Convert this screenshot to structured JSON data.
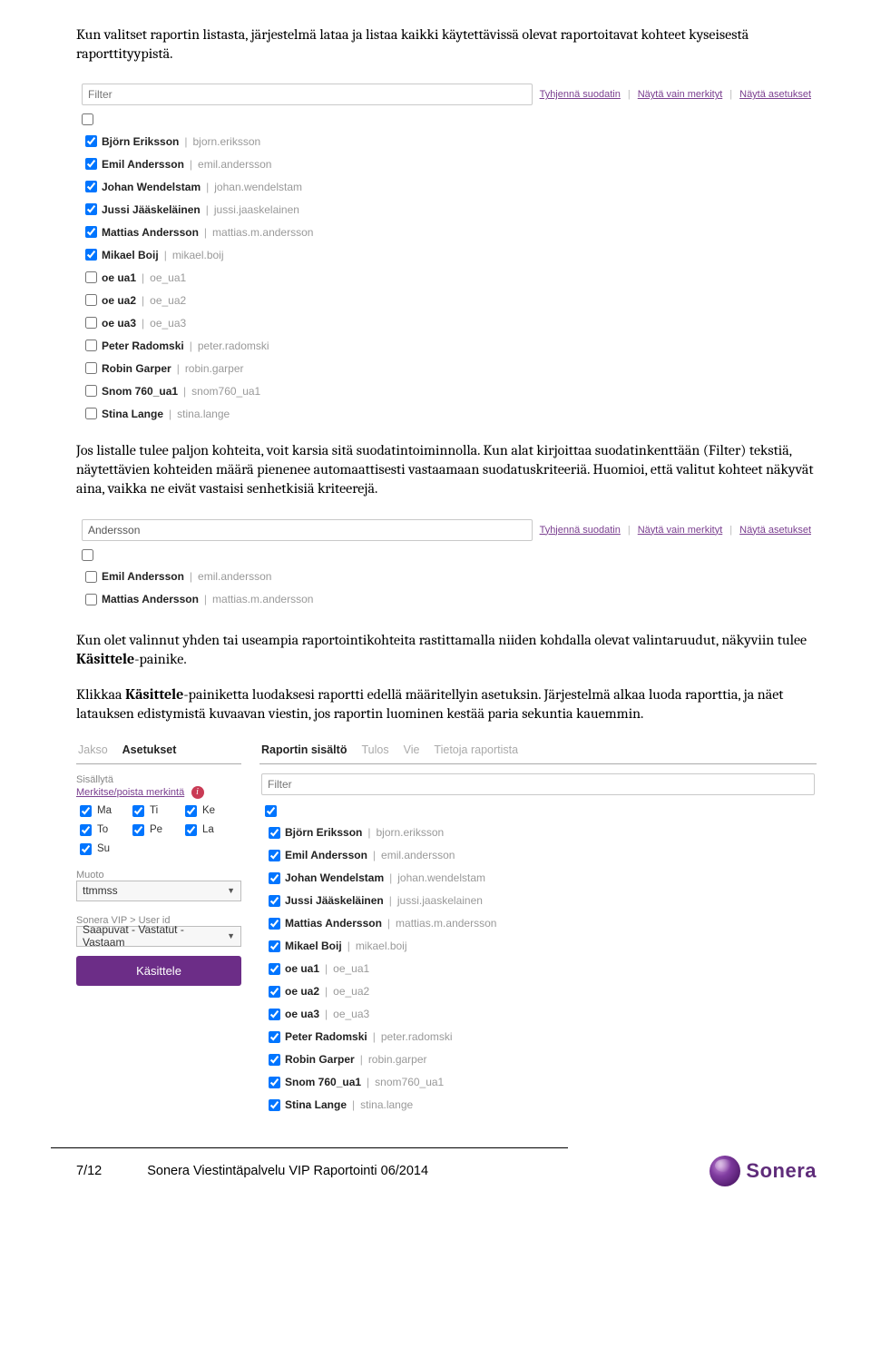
{
  "paragraphs": {
    "p1": "Kun valitset raportin listasta, järjestelmä lataa ja listaa kaikki käytettävissä olevat raportoitavat kohteet kyseisestä raporttityypistä.",
    "p2a": "Jos listalle tulee paljon kohteita, voit karsia sitä suodatintoiminnolla. Kun alat kirjoittaa suodatinkenttään (Filter) tekstiä, näytettävien kohteiden määrä pienenee automaattisesti vastaamaan suodatuskriteeriä. Huomioi, että valitut kohteet näkyvät aina, vaikka ne eivät vastaisi senhetkisiä kriteerejä.",
    "p3a": "Kun olet valinnut yhden tai useampia raportointikohteita rastittamalla niiden kohdalla olevat valintaruudut, näkyviin tulee ",
    "p3b": "Käsittele",
    "p3c": "-painike.",
    "p4a": "Klikkaa ",
    "p4b": "Käsittele",
    "p4c": "-painiketta luodaksesi raportti edellä määritellyin asetuksin. Järjestelmä alkaa luoda raporttia, ja näet latauksen edistymistä kuvaavan viestin, jos raportin luominen kestää paria sekuntia kauemmin."
  },
  "filterLinks": {
    "clear": "Tyhjennä suodatin",
    "marked": "Näytä vain merkityt",
    "settings": "Näytä asetukset"
  },
  "filterPlaceholder": "Filter",
  "filterValue2": "Andersson",
  "list1": [
    {
      "name": "Björn Eriksson",
      "sub": "bjorn.eriksson",
      "checked": true
    },
    {
      "name": "Emil Andersson",
      "sub": "emil.andersson",
      "checked": true
    },
    {
      "name": "Johan Wendelstam",
      "sub": "johan.wendelstam",
      "checked": true
    },
    {
      "name": "Jussi Jääskeläinen",
      "sub": "jussi.jaaskelainen",
      "checked": true
    },
    {
      "name": "Mattias Andersson",
      "sub": "mattias.m.andersson",
      "checked": true
    },
    {
      "name": "Mikael Boij",
      "sub": "mikael.boij",
      "checked": true
    },
    {
      "name": "oe ua1",
      "sub": "oe_ua1",
      "checked": false
    },
    {
      "name": "oe ua2",
      "sub": "oe_ua2",
      "checked": false
    },
    {
      "name": "oe ua3",
      "sub": "oe_ua3",
      "checked": false
    },
    {
      "name": "Peter Radomski",
      "sub": "peter.radomski",
      "checked": false
    },
    {
      "name": "Robin Garper",
      "sub": "robin.garper",
      "checked": false
    },
    {
      "name": "Snom 760_ua1",
      "sub": "snom760_ua1",
      "checked": false
    },
    {
      "name": "Stina Lange",
      "sub": "stina.lange",
      "checked": false
    }
  ],
  "list2": [
    {
      "name": "Emil Andersson",
      "sub": "emil.andersson",
      "checked": false
    },
    {
      "name": "Mattias Andersson",
      "sub": "mattias.m.andersson",
      "checked": false
    }
  ],
  "twoCol": {
    "leftTabs": {
      "a": "Jakso",
      "b": "Asetukset"
    },
    "rightTabs": {
      "a": "Raportin sisältö",
      "b": "Tulos",
      "c": "Vie",
      "d": "Tietoja raportista"
    },
    "include": "Sisällytä",
    "markLink": "Merkitse/poista merkintä",
    "days": {
      "ma": "Ma",
      "ti": "Ti",
      "ke": "Ke",
      "to": "To",
      "pe": "Pe",
      "la": "La",
      "su": "Su"
    },
    "formatLabel": "Muoto",
    "formatValue": "ttmmss",
    "userIdLabel": "Sonera VIP > User id",
    "userIdValue": "Saapuvat - Vastatut - Vastaam",
    "processBtn": "Käsittele"
  },
  "list3": [
    {
      "name": "Björn Eriksson",
      "sub": "bjorn.eriksson",
      "checked": true
    },
    {
      "name": "Emil Andersson",
      "sub": "emil.andersson",
      "checked": true
    },
    {
      "name": "Johan Wendelstam",
      "sub": "johan.wendelstam",
      "checked": true
    },
    {
      "name": "Jussi Jääskeläinen",
      "sub": "jussi.jaaskelainen",
      "checked": true
    },
    {
      "name": "Mattias Andersson",
      "sub": "mattias.m.andersson",
      "checked": true
    },
    {
      "name": "Mikael Boij",
      "sub": "mikael.boij",
      "checked": true
    },
    {
      "name": "oe ua1",
      "sub": "oe_ua1",
      "checked": true
    },
    {
      "name": "oe ua2",
      "sub": "oe_ua2",
      "checked": true
    },
    {
      "name": "oe ua3",
      "sub": "oe_ua3",
      "checked": true
    },
    {
      "name": "Peter Radomski",
      "sub": "peter.radomski",
      "checked": true
    },
    {
      "name": "Robin Garper",
      "sub": "robin.garper",
      "checked": true
    },
    {
      "name": "Snom 760_ua1",
      "sub": "snom760_ua1",
      "checked": true
    },
    {
      "name": "Stina Lange",
      "sub": "stina.lange",
      "checked": true
    }
  ],
  "footer": {
    "page": "7/12",
    "title": "Sonera Viestintäpalvelu VIP Raportointi 06/2014",
    "brand": "Sonera"
  }
}
